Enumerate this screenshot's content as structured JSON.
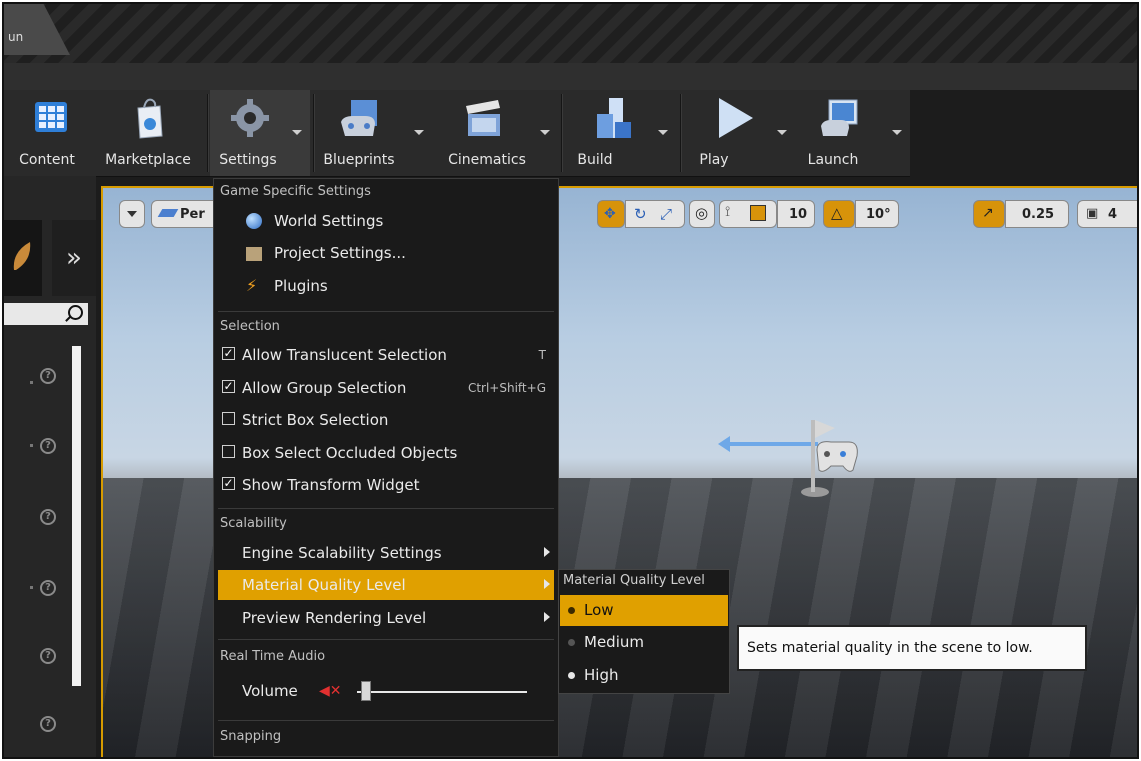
{
  "window": {
    "doc_tab": "un"
  },
  "toolbar": {
    "buttons": [
      {
        "label": "Content",
        "icon": "content-grid-icon"
      },
      {
        "label": "Marketplace",
        "icon": "marketplace-bag-icon"
      },
      {
        "label": "Settings",
        "icon": "settings-gear-icon"
      },
      {
        "label": "Blueprints",
        "icon": "blueprints-icon"
      },
      {
        "label": "Cinematics",
        "icon": "clapperboard-icon"
      },
      {
        "label": "Build",
        "icon": "build-blocks-icon"
      },
      {
        "label": "Play",
        "icon": "play-triangle-icon"
      },
      {
        "label": "Launch",
        "icon": "launch-monitor-icon"
      }
    ]
  },
  "viewport": {
    "view_mode_partial": "Per",
    "grid_snap": "10",
    "rotation_snap": "10°",
    "scale_snap": "0.25",
    "camera_speed_partial": "4"
  },
  "settings_menu": {
    "sections": {
      "game": "Game Specific Settings",
      "selection": "Selection",
      "scalability": "Scalability",
      "audio": "Real Time Audio",
      "snapping": "Snapping"
    },
    "world_settings": "World Settings",
    "project_settings": "Project Settings...",
    "plugins": "Plugins",
    "allow_translucent": {
      "label": "Allow Translucent Selection",
      "shortcut": "T",
      "checked": true
    },
    "allow_group": {
      "label": "Allow Group Selection",
      "shortcut": "Ctrl+Shift+G",
      "checked": true
    },
    "strict_box": {
      "label": "Strict Box Selection",
      "checked": false
    },
    "box_occluded": {
      "label": "Box Select Occluded Objects",
      "checked": false
    },
    "show_transform": {
      "label": "Show Transform Widget",
      "checked": true
    },
    "engine_scalability": "Engine Scalability Settings",
    "material_quality": "Material Quality Level",
    "preview_rendering": "Preview Rendering Level",
    "volume": "Volume",
    "volume_level": 0.02
  },
  "material_submenu": {
    "title": "Material Quality Level",
    "options": [
      "Low",
      "Medium",
      "High"
    ],
    "selected": "Low"
  },
  "tooltip": {
    "text": "Sets material quality in the scene to low."
  },
  "colors": {
    "accent": "#e0a000",
    "menu_bg": "#1a1a1a",
    "viewport_border": "#d79b00"
  }
}
